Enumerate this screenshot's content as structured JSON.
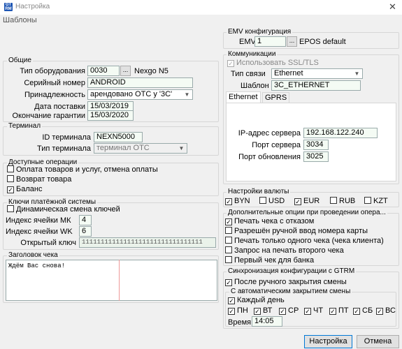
{
  "window": {
    "title": "Настройка",
    "icon_text": "GTRM"
  },
  "menu": {
    "label": "Шаблоны"
  },
  "general": {
    "title": "Общие",
    "equipment_type_label": "Тип оборудования",
    "equipment_type_value": "0030",
    "equipment_type_name": "Nexgo N5",
    "serial_label": "Серийный номер",
    "serial_value": "ANDROID",
    "ownership_label": "Принадлежность",
    "ownership_value": "арендовано ОТС у '3С'",
    "delivery_label": "Дата поставки",
    "delivery_value": "15/03/2019",
    "warranty_label": "Окончание гарантии",
    "warranty_value": "15/03/2020"
  },
  "terminal": {
    "title": "Терминал",
    "id_label": "ID терминала",
    "id_value": "NEXN5000",
    "type_label": "Тип терминала",
    "type_value": "терминал ОТС"
  },
  "operations": {
    "title": "Доступные операции",
    "items": [
      {
        "label": "Оплата товаров и услуг, отмена оплаты",
        "checked": false,
        "mark": ""
      },
      {
        "label": "Возврат товара",
        "checked": false,
        "mark": ""
      },
      {
        "label": "Баланс",
        "checked": true,
        "mark": "✓"
      }
    ]
  },
  "keys": {
    "title": "Ключи платёжной системы",
    "dynamic_label": "Динамическая смена ключей",
    "mk_label": "Индекс ячейки МК",
    "mk_value": "4",
    "wk_label": "Индекс ячейки WK",
    "wk_value": "6",
    "open_key_label": "Открытый ключ",
    "open_key_value": "11111111111111111111111111111111"
  },
  "receipt_header": {
    "title": "Заголовок чека",
    "text": "Ждём Вас снова!"
  },
  "emv": {
    "title": "EMV конфигурация",
    "label": "EMV",
    "value": "1",
    "name": "EPOS default"
  },
  "comm": {
    "title": "Коммуникации",
    "ssl_label": "Использовать SSL/TLS",
    "ssl_mark": "✓",
    "type_label": "Тип связи",
    "type_value": "Ethernet",
    "template_label": "Шаблон",
    "template_value": "3C_ETHERNET",
    "tabs": [
      "Ethernet",
      "GPRS"
    ],
    "ip_label": "IP-адрес сервера",
    "ip_value": "192.168.122.240",
    "port_label": "Порт сервера",
    "port_value": "3034",
    "update_port_label": "Порт обновления",
    "update_port_value": "3025"
  },
  "currency": {
    "title": "Настройки валюты",
    "items": [
      {
        "label": "BYN",
        "mark": "✓"
      },
      {
        "label": "USD",
        "mark": ""
      },
      {
        "label": "EUR",
        "mark": "✓"
      },
      {
        "label": "RUB",
        "mark": ""
      },
      {
        "label": "KZT",
        "mark": ""
      }
    ]
  },
  "extra": {
    "title": "Дополнительные опции при проведении опера...",
    "items": [
      {
        "label": "Печать чека с отказом",
        "mark": "✓"
      },
      {
        "label": "Разрешён ручной ввод номера карты",
        "mark": ""
      },
      {
        "label": "Печать только одного чека (чека клиента)",
        "mark": ""
      },
      {
        "label": "Запрос на печать второго чека",
        "mark": ""
      },
      {
        "label": "Первый чек для банка",
        "mark": ""
      }
    ]
  },
  "sync": {
    "title": "Синхронизация конфигурации с GTRM",
    "after_close_label": "После ручного закрытия смены",
    "auto_title": "С автоматическим закрытием смены",
    "every_day_label": "Каждый день",
    "days": [
      "ПН",
      "ВТ",
      "СР",
      "ЧТ",
      "ПТ",
      "СБ",
      "ВС"
    ],
    "time_label": "Время",
    "time_value": "14:05"
  },
  "footer": {
    "ok_label": "Настройка",
    "cancel_label": "Отмена"
  }
}
